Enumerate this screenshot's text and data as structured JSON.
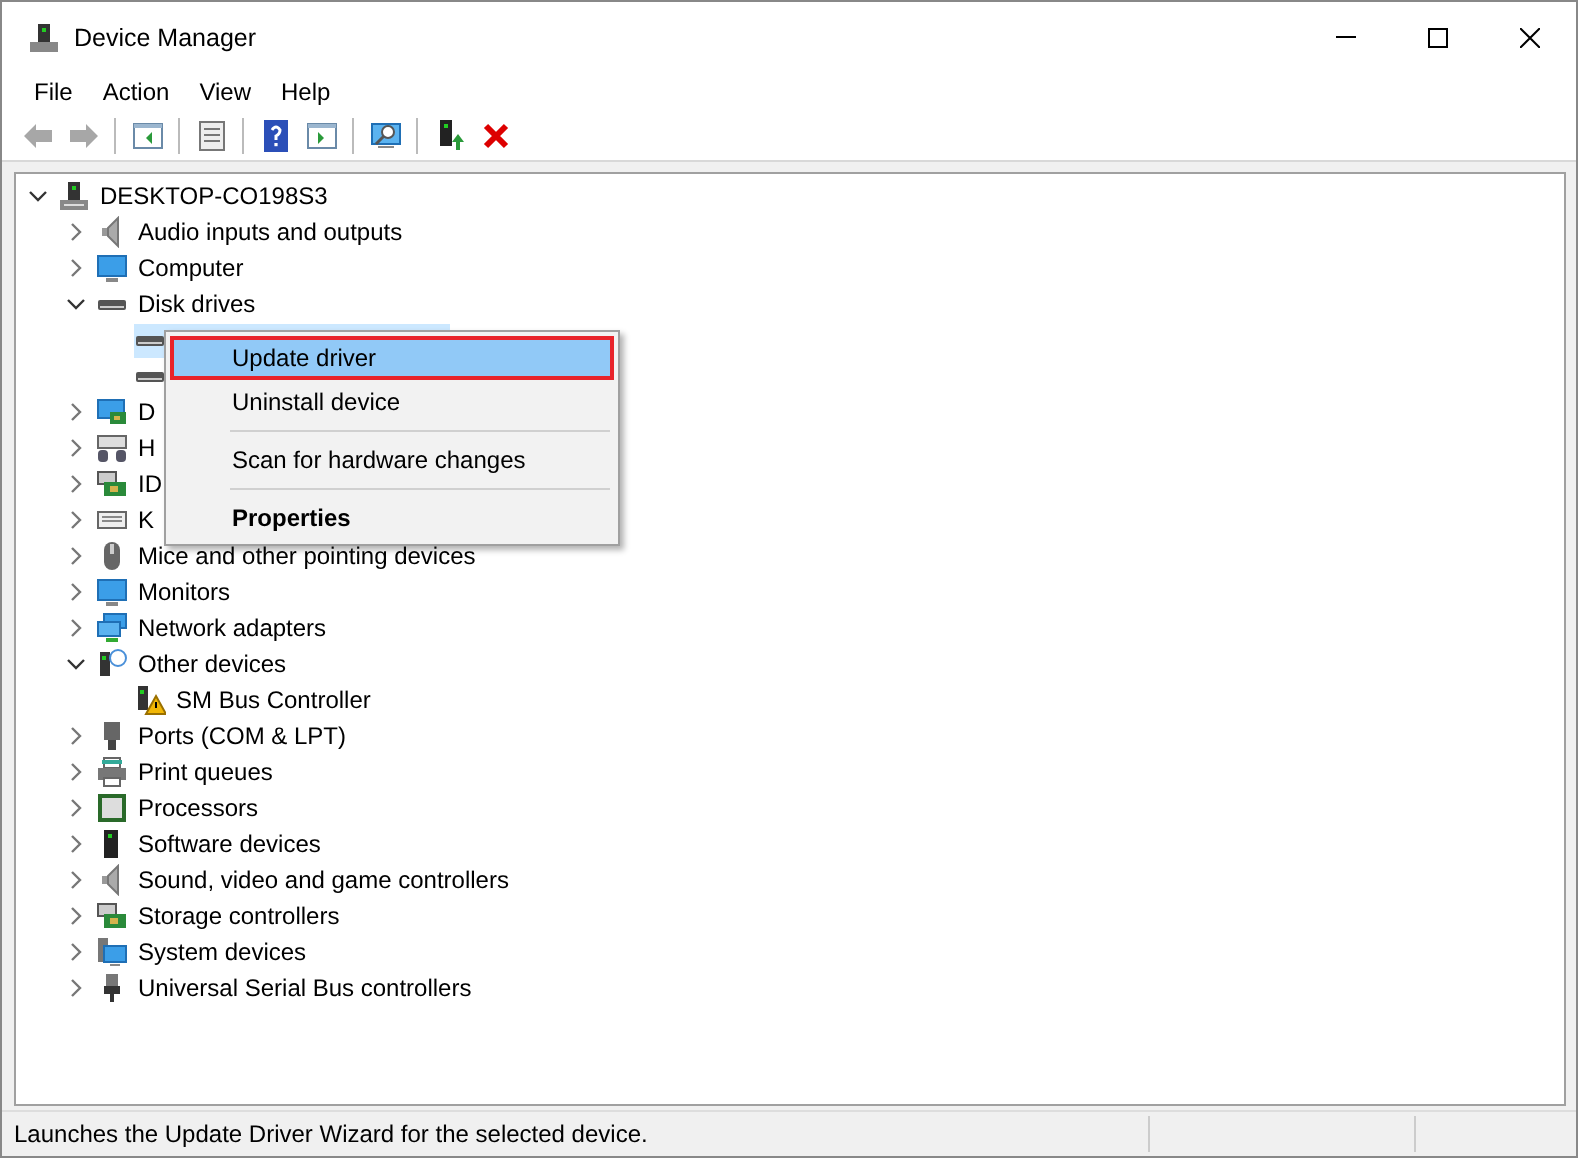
{
  "window": {
    "title": "Device Manager",
    "controls": [
      {
        "kind": "minimize"
      },
      {
        "kind": "maximize"
      },
      {
        "kind": "close"
      }
    ]
  },
  "menu_bar": [
    "File",
    "Action",
    "View",
    "Help"
  ],
  "toolbar": [
    {
      "kind": "back",
      "disabled": true
    },
    {
      "kind": "forward",
      "disabled": true
    },
    {
      "kind": "separator"
    },
    {
      "kind": "tree",
      "disabled": false
    },
    {
      "kind": "separator"
    },
    {
      "kind": "properties",
      "disabled": false
    },
    {
      "kind": "separator"
    },
    {
      "kind": "help",
      "disabled": false
    },
    {
      "kind": "pane",
      "disabled": false
    },
    {
      "kind": "separator"
    },
    {
      "kind": "scan",
      "disabled": false
    },
    {
      "kind": "separator"
    },
    {
      "kind": "update",
      "disabled": false
    },
    {
      "kind": "uninstall",
      "disabled": false
    }
  ],
  "tree": {
    "label": "DESKTOP-CO198S3",
    "kind": "computer",
    "expanded": true,
    "selected": false,
    "children": [
      {
        "label": "Audio inputs and outputs",
        "kind": "speaker",
        "expanded": false,
        "selected": false
      },
      {
        "label": "Computer",
        "kind": "monitor",
        "expanded": false,
        "selected": false
      },
      {
        "label": "Disk drives",
        "kind": "disk",
        "expanded": true,
        "selected": false,
        "children": [
          {
            "kind": "disk",
            "selected": true
          },
          {
            "kind": "disk",
            "selected": false
          }
        ]
      },
      {
        "label": "D",
        "kind": "display",
        "expanded": false,
        "selected": false
      },
      {
        "label": "H",
        "kind": "keyboard-mouse",
        "expanded": false,
        "selected": false
      },
      {
        "label": "ID",
        "kind": "controller",
        "expanded": false,
        "selected": false
      },
      {
        "label": "K",
        "kind": "keyboard",
        "expanded": false,
        "selected": false
      },
      {
        "label": "Mice and other pointing devices",
        "kind": "mouse",
        "expanded": false,
        "selected": false
      },
      {
        "label": "Monitors",
        "kind": "monitor",
        "expanded": false,
        "selected": false
      },
      {
        "label": "Network adapters",
        "kind": "network",
        "expanded": false,
        "selected": false
      },
      {
        "label": "Other devices",
        "kind": "unknown",
        "expanded": true,
        "selected": false,
        "children": [
          {
            "label": "SM Bus Controller",
            "kind": "warning",
            "selected": false
          }
        ]
      },
      {
        "label": "Ports (COM & LPT)",
        "kind": "port",
        "expanded": false,
        "selected": false
      },
      {
        "label": "Print queues",
        "kind": "printer",
        "expanded": false,
        "selected": false
      },
      {
        "label": "Processors",
        "kind": "chip",
        "expanded": false,
        "selected": false
      },
      {
        "label": "Software devices",
        "kind": "tower",
        "expanded": false,
        "selected": false
      },
      {
        "label": "Sound, video and game controllers",
        "kind": "speaker",
        "expanded": false,
        "selected": false
      },
      {
        "label": "Storage controllers",
        "kind": "controller",
        "expanded": false,
        "selected": false
      },
      {
        "label": "System devices",
        "kind": "system",
        "expanded": false,
        "selected": false
      },
      {
        "label": "Universal Serial Bus controllers",
        "kind": "usb",
        "expanded": false,
        "selected": false
      }
    ]
  },
  "context_menu": [
    {
      "kind": "item",
      "label": "Update driver",
      "selected": true,
      "bold": false
    },
    {
      "kind": "item",
      "label": "Uninstall device",
      "selected": false,
      "bold": false
    },
    {
      "kind": "separator"
    },
    {
      "kind": "item",
      "label": "Scan for hardware changes",
      "selected": false,
      "bold": false
    },
    {
      "kind": "separator"
    },
    {
      "kind": "item",
      "label": "Properties",
      "selected": false,
      "bold": true
    }
  ],
  "status_bar": {
    "text": "Launches the Update Driver Wizard for the selected device."
  }
}
